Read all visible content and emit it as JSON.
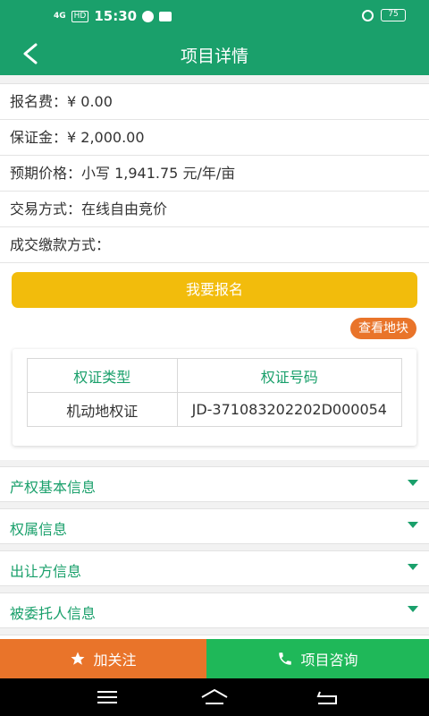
{
  "status_bar": {
    "network": "4G",
    "hd": "HD",
    "time": "15:30",
    "battery": "75"
  },
  "header": {
    "title": "项目详情"
  },
  "info_rows": [
    {
      "label": "报名费：",
      "value": "¥ 0.00"
    },
    {
      "label": "保证金：",
      "value": "¥ 2,000.00"
    },
    {
      "label": "预期价格：",
      "value": "小写 1,941.75 元/年/亩"
    },
    {
      "label": "交易方式：",
      "value": "在线自由竞价"
    },
    {
      "label": "成交缴款方式：",
      "value": ""
    }
  ],
  "actions": {
    "signup_label": "我要报名",
    "view_plot_label": "查看地块"
  },
  "cert_table": {
    "headers": [
      "权证类型",
      "权证号码"
    ],
    "rows": [
      [
        "机动地权证",
        "JD-371083202202D000054"
      ]
    ]
  },
  "sections": [
    {
      "label": "产权基本信息"
    },
    {
      "label": "权属信息"
    },
    {
      "label": "出让方信息"
    },
    {
      "label": "被委托人信息"
    }
  ],
  "bottom_bar": {
    "follow_label": "加关注",
    "consult_label": "项目咨询"
  },
  "colors": {
    "primary_green": "#1aa06b",
    "signup_yellow": "#f2bc0c",
    "accent_orange": "#e9742a",
    "consult_green": "#1fb859"
  },
  "icons": {
    "back": "chevron-left-icon",
    "follow": "star-icon",
    "consult": "phone-icon",
    "section_toggle": "caret-down-icon",
    "nav_menu": "menu-icon",
    "nav_home": "home-icon",
    "nav_back": "back-icon"
  }
}
